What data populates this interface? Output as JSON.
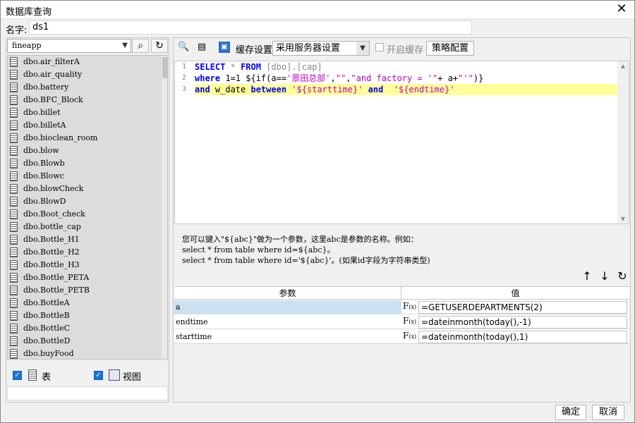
{
  "window": {
    "title": "数据库查询"
  },
  "name_field": {
    "label": "名字:",
    "value": "ds1"
  },
  "left": {
    "db_select": "fineapp",
    "tables": [
      "dbo.air_filterA",
      "dbo.air_quality",
      "dbo.battery",
      "dbo.BFC_Block",
      "dbo.billet",
      "dbo.billetA",
      "dbo.bioclean_room",
      "dbo.blow",
      "dbo.Blowb",
      "dbo.Blowc",
      "dbo.blowCheck",
      "dbo.BlowD",
      "dbo.Boot_check",
      "dbo.bottle_cap",
      "dbo.Bottle_H1",
      "dbo.Bottle_H2",
      "dbo.Bottle_H3",
      "dbo.Bottle_PETA",
      "dbo.Bottle_PETB",
      "dbo.BottleA",
      "dbo.BottleB",
      "dbo.BottleC",
      "dbo.BottleD",
      "dbo.buyFood"
    ],
    "table_checkbox": "表",
    "view_checkbox": "视图"
  },
  "toolbar": {
    "cache_settings": "缓存设置",
    "cache_mode": "采用服务器设置",
    "enable_cache": "开启缓存",
    "strategy": "策略配置"
  },
  "editor": {
    "line_numbers": [
      "1",
      "2",
      "3"
    ]
  },
  "hint": {
    "line1": "您可以键入\"${abc}\"做为一个参数，这里abc是参数的名称。例如：",
    "line2": "select * from table where id=${abc}。",
    "line3": "select * from table where id='${abc}'。(如果id字段为字符串类型)"
  },
  "params": {
    "col_name": "参数",
    "col_value": "值",
    "rows": [
      {
        "name": "a",
        "value": "=GETUSERDEPARTMENTS(2)"
      },
      {
        "name": "endtime",
        "value": "=dateinmonth(today(),-1)"
      },
      {
        "name": "starttime",
        "value": "=dateinmonth(today(),1)"
      }
    ]
  },
  "buttons": {
    "ok": "确定",
    "cancel": "取消"
  }
}
